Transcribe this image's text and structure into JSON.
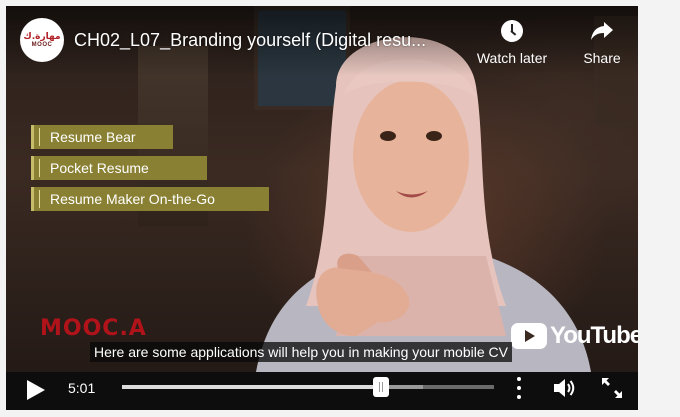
{
  "header": {
    "channel_logo": {
      "arabic": "مهارة.ك",
      "text": "MOOC"
    },
    "title": "CH02_L07_Branding yourself (Digital resu...",
    "watch_later_label": "Watch later",
    "share_label": "Share"
  },
  "video": {
    "lower_third": [
      {
        "label": "Resume Bear"
      },
      {
        "label": "Pocket Resume"
      },
      {
        "label": "Resume Maker On-the-Go"
      }
    ],
    "watermark": "MOOC.A",
    "platform_word": "YouTube",
    "caption": "Here are some applications will help you in making your mobile CV",
    "accent_color": "#8a8033"
  },
  "controls": {
    "current_time": "5:01",
    "progress_fraction": 0.695,
    "buffered_fraction": 0.81
  },
  "icons": [
    "channel-logo",
    "clock-icon",
    "share-icon",
    "youtube-logo",
    "play-icon",
    "more-vert-icon",
    "volume-icon",
    "fullscreen-icon"
  ]
}
